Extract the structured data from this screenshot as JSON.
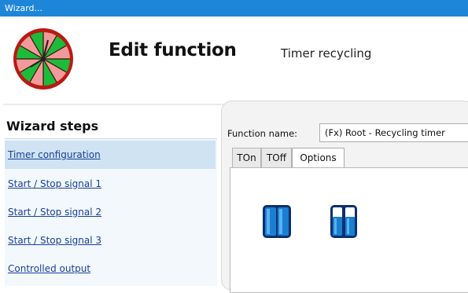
{
  "window": {
    "title": "Wizard..."
  },
  "header": {
    "title": "Edit function",
    "subtitle": "Timer recycling",
    "logo_icon": "timer-wheel-icon"
  },
  "wizard": {
    "title": "Wizard steps",
    "steps": [
      {
        "label": "Timer configuration",
        "active": true
      },
      {
        "label": "Start / Stop signal 1",
        "active": false
      },
      {
        "label": "Start / Stop signal 2",
        "active": false
      },
      {
        "label": "Start / Stop signal 3",
        "active": false
      },
      {
        "label": "Controlled output",
        "active": false
      }
    ]
  },
  "form": {
    "function_name_label": "Function name:",
    "function_name_value": "(Fx) Root - Recycling timer"
  },
  "tabs": [
    {
      "label": "TOn",
      "active": false
    },
    {
      "label": "TOff",
      "active": false
    },
    {
      "label": "Options",
      "active": true
    }
  ],
  "options": {
    "icons": [
      "dual-blue-switch-icon",
      "dual-white-blue-switch-icon"
    ]
  },
  "colors": {
    "titlebar": "#1e86d8",
    "link": "#1a3f9a",
    "active_step": "#cfe3f2",
    "icon_blue": "#1b7fd1"
  }
}
